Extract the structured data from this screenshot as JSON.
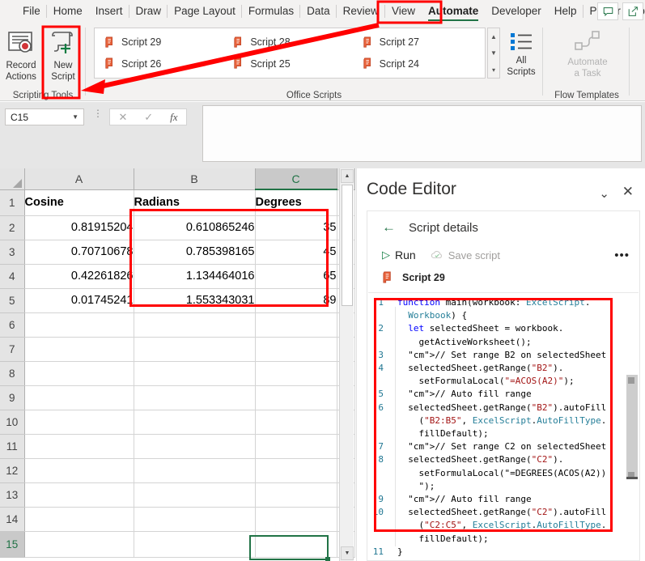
{
  "window": {
    "app": "Microsoft Excel"
  },
  "ribbon_tabs": [
    {
      "label": "File",
      "active": false
    },
    {
      "label": "Home",
      "active": false
    },
    {
      "label": "Insert",
      "active": false
    },
    {
      "label": "Draw",
      "active": false
    },
    {
      "label": "Page Layout",
      "active": false
    },
    {
      "label": "Formulas",
      "active": false
    },
    {
      "label": "Data",
      "active": false
    },
    {
      "label": "Review",
      "active": false
    },
    {
      "label": "View",
      "active": false
    },
    {
      "label": "Automate",
      "active": true
    },
    {
      "label": "Developer",
      "active": false
    },
    {
      "label": "Help",
      "active": false
    },
    {
      "label": "Power Pivot",
      "active": false
    }
  ],
  "tabbar_buttons": [
    {
      "name": "comments-icon",
      "glyph": "💬"
    },
    {
      "name": "share-icon",
      "glyph": "↗"
    }
  ],
  "ribbon": {
    "groups": [
      {
        "name": "scripting-tools",
        "label": "Scripting Tools"
      },
      {
        "name": "office-scripts",
        "label": "Office Scripts"
      },
      {
        "name": "flow-templates",
        "label": "Flow Templates"
      }
    ],
    "record_actions": {
      "line1": "Record",
      "line2": "Actions"
    },
    "new_script": {
      "line1": "New",
      "line2": "Script"
    },
    "all_scripts": {
      "line1": "All",
      "line2": "Scripts"
    },
    "automate_task": {
      "line1": "Automate",
      "line2": "a Task",
      "disabled": true
    },
    "script_gallery": [
      "Script 29",
      "Script 28",
      "Script 27",
      "Script 26",
      "Script 25",
      "Script 24"
    ],
    "gallery_scroll": {
      "up": "▲",
      "down": "▼",
      "more": "▾"
    }
  },
  "formula_bar": {
    "name_box_value": "C15",
    "name_box_caret": "▼",
    "cancel_icon": "✕",
    "enter_icon": "✓",
    "fx_icon": "fx",
    "formula_value": ""
  },
  "sheet": {
    "columns": [
      "A",
      "B",
      "C"
    ],
    "selected_column": "C",
    "selected_cell": "C15",
    "rows": [
      {
        "num": "1",
        "cells": [
          "Cosine",
          "Radians",
          "Degrees"
        ],
        "header": true
      },
      {
        "num": "2",
        "cells": [
          "0.81915204",
          "0.610865246",
          "35"
        ]
      },
      {
        "num": "3",
        "cells": [
          "0.70710678",
          "0.785398165",
          "45"
        ]
      },
      {
        "num": "4",
        "cells": [
          "0.42261826",
          "1.134464016",
          "65"
        ]
      },
      {
        "num": "5",
        "cells": [
          "0.01745241",
          "1.553343031",
          "89"
        ]
      },
      {
        "num": "6",
        "cells": [
          "",
          "",
          ""
        ]
      },
      {
        "num": "7",
        "cells": [
          "",
          "",
          ""
        ]
      },
      {
        "num": "8",
        "cells": [
          "",
          "",
          ""
        ]
      },
      {
        "num": "9",
        "cells": [
          "",
          "",
          ""
        ]
      },
      {
        "num": "10",
        "cells": [
          "",
          "",
          ""
        ]
      },
      {
        "num": "11",
        "cells": [
          "",
          "",
          ""
        ]
      },
      {
        "num": "12",
        "cells": [
          "",
          "",
          ""
        ]
      },
      {
        "num": "13",
        "cells": [
          "",
          "",
          ""
        ]
      },
      {
        "num": "14",
        "cells": [
          "",
          "",
          ""
        ]
      },
      {
        "num": "15",
        "cells": [
          "",
          "",
          ""
        ]
      }
    ]
  },
  "code_editor": {
    "title": "Code Editor",
    "collapse_icon": "⌄",
    "close_icon": "✕",
    "back_icon": "←",
    "back_label": "Script details",
    "run_label": "Run",
    "run_icon": "▷",
    "save_label": "Save script",
    "more_icon": "•••",
    "script_name": "Script 29",
    "code_lines": [
      {
        "n": "1",
        "text": "function main(workbook: ExcelScript.\n  Workbook) {"
      },
      {
        "n": "2",
        "text": "  let selectedSheet = workbook.\n    getActiveWorksheet();"
      },
      {
        "n": "3",
        "text": "  // Set range B2 on selectedSheet"
      },
      {
        "n": "4",
        "text": "  selectedSheet.getRange(\"B2\").\n    setFormulaLocal(\"=ACOS(A2)\");"
      },
      {
        "n": "5",
        "text": "  // Auto fill range"
      },
      {
        "n": "6",
        "text": "  selectedSheet.getRange(\"B2\").autoFill\n    (\"B2:B5\", ExcelScript.AutoFillType.\n    fillDefault);"
      },
      {
        "n": "7",
        "text": "  // Set range C2 on selectedSheet"
      },
      {
        "n": "8",
        "text": "  selectedSheet.getRange(\"C2\").\n    setFormulaLocal(\"=DEGREES(ACOS(A2))\n    \");"
      },
      {
        "n": "9",
        "text": "  // Auto fill range"
      },
      {
        "n": "10",
        "text": "  selectedSheet.getRange(\"C2\").autoFill\n    (\"C2:C5\", ExcelScript.AutoFillType.\n    fillDefault);"
      },
      {
        "n": "11",
        "text": "}"
      }
    ]
  },
  "annotations": {
    "highlight_color": "#ff0000",
    "arrow_from": "Automate tab",
    "arrow_to": "New Script button"
  }
}
